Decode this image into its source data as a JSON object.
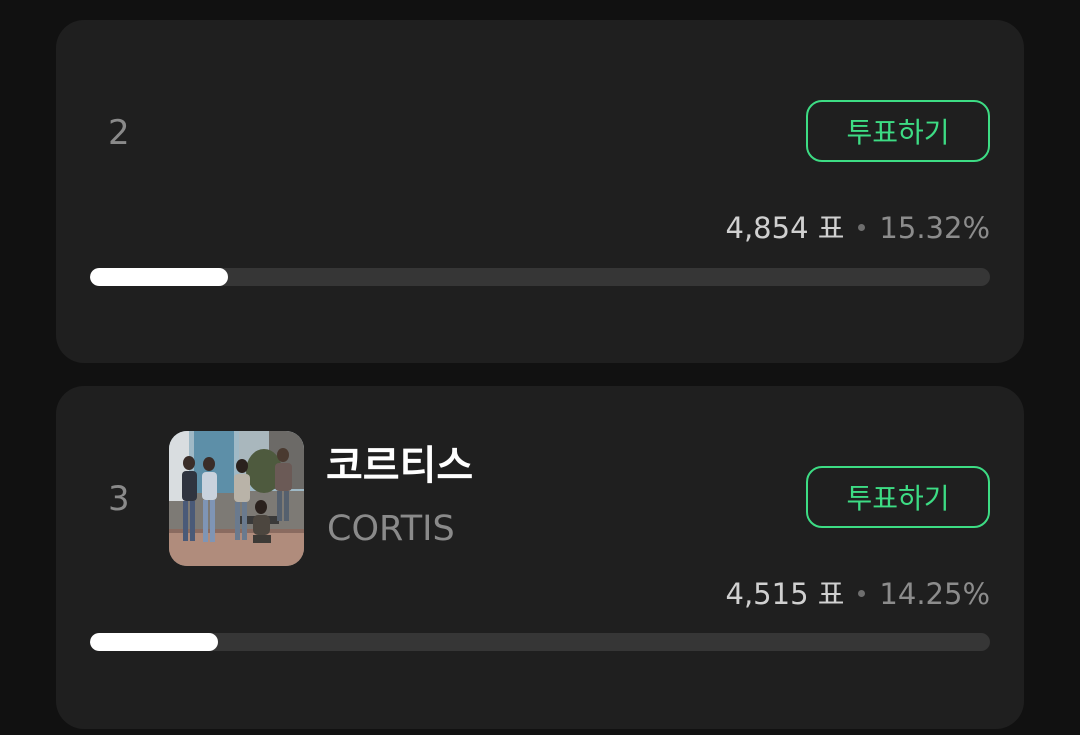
{
  "entries": [
    {
      "rank": "2",
      "name": "",
      "name_en": "",
      "vote_label": "투표하기",
      "votes": "4,854 표",
      "percent_text": "15.32%",
      "percent": 15.32
    },
    {
      "rank": "3",
      "name": "코르티스",
      "name_en": "CORTIS",
      "vote_label": "투표하기",
      "votes": "4,515 표",
      "percent_text": "14.25%",
      "percent": 14.25
    }
  ],
  "colors": {
    "accent": "#3ddc84",
    "card": "#1f1f1f",
    "background": "#111111",
    "bar_track": "#363636",
    "bar_fill": "#ffffff"
  },
  "icons": {
    "separator": "dot"
  }
}
